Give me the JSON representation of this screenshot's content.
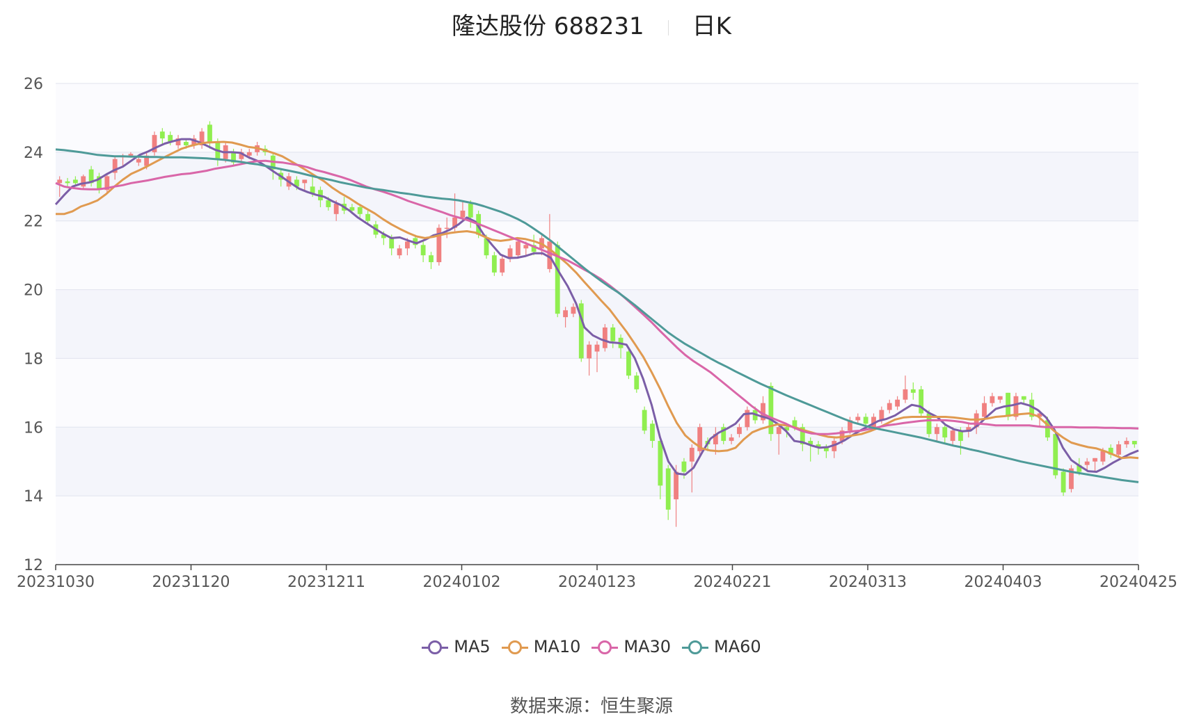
{
  "title": {
    "name": "隆达股份 688231",
    "period": "日K"
  },
  "source": {
    "label": "数据来源：",
    "value": "恒生聚源"
  },
  "colors": {
    "up": "#f08080",
    "down": "#90ee50",
    "ma5": "#7b5ea7",
    "ma10": "#e09a50",
    "ma30": "#d966a8",
    "ma60": "#4e9a98",
    "band": "#f4f5fb",
    "grid": "#e0e3ee"
  },
  "chart_data": {
    "type": "candlestick",
    "title": "隆达股份 688231 日K",
    "ylim": [
      12,
      26
    ],
    "yticks": [
      "26",
      "24",
      "22",
      "20",
      "18",
      "16",
      "14",
      "12"
    ],
    "xticks": [
      "20231030",
      "20231120",
      "20231211",
      "20240102",
      "20240123",
      "20240221",
      "20240313",
      "20240403",
      "20240425"
    ],
    "grid": true,
    "legend_position": "bottom",
    "candles": [
      [
        23.1,
        23.2,
        22.7,
        23.3
      ],
      [
        23.15,
        23.1,
        23.0,
        23.25
      ],
      [
        23.2,
        23.1,
        23.0,
        23.3
      ],
      [
        23.0,
        23.3,
        22.9,
        23.35
      ],
      [
        23.5,
        23.1,
        23.0,
        23.6
      ],
      [
        23.3,
        22.9,
        22.8,
        23.4
      ],
      [
        22.9,
        23.3,
        22.8,
        23.4
      ],
      [
        23.4,
        23.8,
        23.2,
        23.9
      ],
      [
        23.85,
        23.9,
        23.6,
        23.95
      ],
      [
        23.9,
        23.95,
        23.85,
        24.0
      ],
      [
        23.7,
        23.8,
        23.6,
        23.9
      ],
      [
        23.6,
        23.9,
        23.5,
        24.0
      ],
      [
        24.0,
        24.5,
        23.9,
        24.6
      ],
      [
        24.6,
        24.4,
        24.2,
        24.7
      ],
      [
        24.5,
        24.3,
        24.2,
        24.6
      ],
      [
        24.2,
        24.4,
        24.1,
        24.5
      ],
      [
        24.3,
        24.2,
        24.1,
        24.4
      ],
      [
        24.2,
        24.4,
        24.1,
        24.5
      ],
      [
        24.2,
        24.6,
        24.1,
        24.7
      ],
      [
        24.8,
        24.3,
        24.1,
        24.9
      ],
      [
        24.3,
        23.8,
        23.6,
        24.4
      ],
      [
        23.8,
        24.2,
        23.7,
        24.3
      ],
      [
        24.0,
        23.7,
        23.6,
        24.1
      ],
      [
        23.8,
        24.0,
        23.7,
        24.1
      ],
      [
        23.9,
        24.0,
        23.8,
        24.1
      ],
      [
        24.0,
        24.2,
        23.9,
        24.3
      ],
      [
        24.1,
        24.0,
        23.9,
        24.2
      ],
      [
        23.9,
        23.5,
        23.2,
        24.0
      ],
      [
        23.4,
        23.2,
        23.0,
        23.5
      ],
      [
        23.0,
        23.3,
        22.9,
        23.4
      ],
      [
        23.2,
        23.0,
        22.9,
        23.3
      ],
      [
        23.1,
        23.2,
        22.9,
        23.2
      ],
      [
        23.0,
        22.8,
        22.7,
        23.3
      ],
      [
        22.9,
        22.6,
        22.4,
        23.0
      ],
      [
        22.6,
        22.4,
        22.3,
        22.7
      ],
      [
        22.2,
        22.5,
        22.0,
        22.6
      ],
      [
        22.5,
        22.3,
        22.2,
        22.7
      ],
      [
        22.4,
        22.3,
        22.2,
        22.5
      ],
      [
        22.4,
        22.2,
        22.1,
        22.5
      ],
      [
        22.2,
        22.0,
        21.9,
        22.3
      ],
      [
        21.9,
        21.6,
        21.5,
        22.0
      ],
      [
        21.6,
        21.5,
        21.3,
        21.7
      ],
      [
        21.5,
        21.2,
        21.0,
        21.6
      ],
      [
        21.0,
        21.2,
        20.9,
        21.3
      ],
      [
        21.2,
        21.4,
        21.0,
        21.5
      ],
      [
        21.5,
        21.3,
        21.2,
        21.6
      ],
      [
        21.3,
        21.0,
        20.8,
        21.4
      ],
      [
        21.0,
        20.8,
        20.6,
        21.1
      ],
      [
        20.8,
        21.8,
        20.7,
        21.9
      ],
      [
        21.8,
        21.8,
        21.5,
        22.1
      ],
      [
        21.8,
        22.1,
        21.7,
        22.8
      ],
      [
        22.1,
        22.3,
        22.0,
        22.6
      ],
      [
        22.5,
        22.1,
        21.8,
        22.6
      ],
      [
        22.2,
        21.6,
        21.5,
        22.3
      ],
      [
        21.5,
        21.0,
        20.9,
        21.6
      ],
      [
        21.0,
        20.5,
        20.4,
        21.1
      ],
      [
        20.5,
        20.9,
        20.4,
        21.0
      ],
      [
        20.9,
        21.2,
        20.8,
        21.3
      ],
      [
        21.0,
        21.4,
        20.9,
        21.5
      ],
      [
        21.2,
        21.3,
        21.0,
        21.4
      ],
      [
        21.3,
        21.1,
        21.0,
        21.6
      ],
      [
        21.2,
        21.5,
        21.0,
        21.6
      ],
      [
        20.6,
        21.4,
        20.5,
        22.2
      ],
      [
        21.3,
        19.3,
        19.2,
        21.4
      ],
      [
        19.2,
        19.4,
        18.9,
        19.5
      ],
      [
        19.3,
        19.5,
        19.2,
        19.6
      ],
      [
        19.6,
        18.0,
        17.9,
        19.7
      ],
      [
        18.0,
        18.4,
        17.5,
        18.5
      ],
      [
        18.2,
        18.4,
        17.6,
        18.5
      ],
      [
        18.3,
        18.9,
        18.2,
        19.0
      ],
      [
        18.9,
        18.5,
        18.3,
        19.0
      ],
      [
        18.6,
        18.3,
        18.0,
        18.7
      ],
      [
        18.2,
        17.5,
        17.4,
        18.3
      ],
      [
        17.5,
        17.1,
        17.0,
        17.6
      ],
      [
        16.5,
        15.9,
        15.8,
        16.6
      ],
      [
        16.1,
        15.6,
        15.4,
        16.2
      ],
      [
        15.6,
        14.3,
        13.9,
        15.7
      ],
      [
        14.8,
        13.6,
        13.3,
        14.9
      ],
      [
        13.9,
        14.7,
        13.1,
        14.9
      ],
      [
        15.0,
        14.7,
        14.5,
        15.1
      ],
      [
        15.0,
        15.4,
        14.1,
        15.5
      ],
      [
        15.3,
        16.0,
        15.2,
        16.1
      ],
      [
        15.6,
        15.5,
        15.3,
        15.7
      ],
      [
        15.5,
        15.8,
        15.2,
        16.0
      ],
      [
        16.0,
        15.6,
        15.5,
        16.1
      ],
      [
        15.6,
        15.7,
        15.5,
        15.8
      ],
      [
        15.8,
        16.0,
        15.7,
        16.1
      ],
      [
        16.0,
        16.5,
        15.9,
        16.6
      ],
      [
        16.5,
        16.2,
        16.1,
        16.6
      ],
      [
        16.2,
        16.7,
        16.1,
        16.9
      ],
      [
        17.2,
        15.8,
        15.6,
        17.3
      ],
      [
        15.8,
        16.0,
        15.2,
        16.1
      ],
      [
        16.0,
        15.9,
        15.7,
        16.1
      ],
      [
        16.2,
        16.0,
        15.9,
        16.3
      ],
      [
        16.0,
        15.5,
        15.3,
        16.1
      ],
      [
        15.6,
        15.5,
        15.0,
        15.7
      ],
      [
        15.5,
        15.4,
        15.2,
        15.6
      ],
      [
        15.4,
        15.3,
        15.1,
        15.5
      ],
      [
        15.3,
        15.6,
        15.1,
        15.7
      ],
      [
        15.6,
        15.9,
        15.5,
        16.0
      ],
      [
        15.9,
        16.2,
        15.8,
        16.3
      ],
      [
        16.2,
        16.3,
        16.1,
        16.4
      ],
      [
        16.3,
        16.1,
        16.0,
        16.4
      ],
      [
        16.0,
        16.3,
        15.9,
        16.4
      ],
      [
        16.2,
        16.5,
        16.1,
        16.6
      ],
      [
        16.5,
        16.7,
        16.4,
        16.8
      ],
      [
        16.6,
        16.8,
        16.5,
        16.9
      ],
      [
        16.8,
        17.1,
        16.7,
        17.5
      ],
      [
        17.1,
        17.0,
        16.8,
        17.3
      ],
      [
        17.1,
        16.4,
        16.3,
        17.2
      ],
      [
        16.4,
        15.8,
        15.7,
        16.5
      ],
      [
        15.8,
        16.0,
        15.6,
        16.1
      ],
      [
        16.0,
        15.7,
        15.5,
        16.1
      ],
      [
        15.6,
        15.9,
        15.5,
        16.0
      ],
      [
        15.9,
        15.6,
        15.2,
        16.0
      ],
      [
        15.9,
        16.0,
        15.7,
        16.1
      ],
      [
        16.0,
        16.4,
        15.8,
        16.5
      ],
      [
        16.3,
        16.7,
        16.2,
        16.9
      ],
      [
        16.7,
        16.9,
        16.6,
        17.0
      ],
      [
        16.8,
        16.9,
        16.7,
        16.9
      ],
      [
        17.0,
        16.3,
        16.2,
        17.0
      ],
      [
        16.3,
        16.9,
        16.2,
        17.0
      ],
      [
        16.9,
        16.8,
        16.7,
        16.9
      ],
      [
        16.8,
        16.3,
        16.2,
        17.0
      ],
      [
        16.3,
        16.4,
        16.0,
        16.5
      ],
      [
        16.2,
        15.7,
        15.6,
        16.3
      ],
      [
        15.8,
        14.6,
        14.5,
        15.9
      ],
      [
        14.7,
        14.1,
        14.0,
        14.8
      ],
      [
        14.2,
        14.8,
        14.1,
        14.9
      ],
      [
        14.9,
        14.7,
        14.6,
        15.1
      ],
      [
        14.9,
        15.0,
        14.7,
        15.1
      ],
      [
        15.0,
        15.1,
        14.7,
        15.1
      ],
      [
        15.0,
        15.3,
        14.9,
        15.4
      ],
      [
        15.4,
        15.2,
        15.1,
        15.5
      ],
      [
        15.2,
        15.5,
        15.1,
        15.6
      ],
      [
        15.5,
        15.6,
        15.4,
        15.7
      ],
      [
        15.6,
        15.5,
        15.4,
        15.6
      ]
    ],
    "series": [
      {
        "name": "MA5",
        "values": [
          22.48,
          22.75,
          23.0,
          23.08,
          23.12,
          23.2,
          23.35,
          23.48,
          23.58,
          23.75,
          23.92,
          24.02,
          24.14,
          24.25,
          24.32,
          24.38,
          24.38,
          24.3,
          24.19,
          24.07,
          24.0,
          24.0,
          23.98,
          23.85,
          23.75,
          23.6,
          23.43,
          23.27,
          23.1,
          22.94,
          22.84,
          22.76,
          22.7,
          22.57,
          22.46,
          22.3,
          22.1,
          21.94,
          21.78,
          21.63,
          21.5,
          21.52,
          21.43,
          21.35,
          21.45,
          21.58,
          21.64,
          21.75,
          21.9,
          22.1,
          21.98,
          21.6,
          21.3,
          21.02,
          20.92,
          20.93,
          20.98,
          21.06,
          21.06,
          20.92,
          20.5,
          20.1,
          19.6,
          18.9,
          18.67,
          18.55,
          18.47,
          18.45,
          18.4,
          18.0,
          17.4,
          16.65,
          15.7,
          15.0,
          14.65,
          14.62,
          14.82,
          15.26,
          15.66,
          15.84,
          15.96,
          16.1,
          16.38,
          16.4,
          16.32,
          16.25,
          16.1,
          15.89,
          15.6,
          15.56,
          15.47,
          15.4,
          15.42,
          15.5,
          15.62,
          15.78,
          15.92,
          16.05,
          16.18,
          16.24,
          16.34,
          16.5,
          16.65,
          16.6,
          16.42,
          16.3,
          16.07,
          15.94,
          15.88,
          15.9,
          16.08,
          16.32,
          16.53,
          16.6,
          16.64,
          16.7,
          16.63,
          16.5,
          16.28,
          15.92,
          15.4,
          15.04,
          14.87,
          14.72,
          14.7,
          14.82,
          14.97,
          15.1,
          15.22,
          15.32
        ]
      },
      {
        "name": "MA10",
        "values": [
          22.2,
          22.2,
          22.28,
          22.42,
          22.5,
          22.6,
          22.78,
          23.0,
          23.2,
          23.37,
          23.48,
          23.6,
          23.73,
          23.86,
          23.98,
          24.1,
          24.18,
          24.24,
          24.28,
          24.29,
          24.3,
          24.28,
          24.22,
          24.15,
          24.12,
          24.05,
          23.97,
          23.88,
          23.74,
          23.6,
          23.45,
          23.3,
          23.15,
          22.96,
          22.8,
          22.66,
          22.5,
          22.36,
          22.22,
          22.05,
          21.9,
          21.77,
          21.65,
          21.55,
          21.5,
          21.54,
          21.6,
          21.65,
          21.68,
          21.7,
          21.66,
          21.55,
          21.45,
          21.42,
          21.45,
          21.5,
          21.47,
          21.41,
          21.32,
          21.15,
          20.95,
          20.74,
          20.5,
          20.22,
          19.95,
          19.68,
          19.42,
          19.1,
          18.78,
          18.42,
          18.05,
          17.6,
          17.12,
          16.6,
          16.12,
          15.76,
          15.55,
          15.38,
          15.32,
          15.3,
          15.32,
          15.4,
          15.65,
          15.85,
          15.95,
          16.02,
          16.08,
          16.05,
          16.0,
          15.92,
          15.85,
          15.78,
          15.72,
          15.7,
          15.72,
          15.76,
          15.8,
          15.88,
          15.98,
          16.1,
          16.22,
          16.28,
          16.3,
          16.3,
          16.3,
          16.3,
          16.3,
          16.28,
          16.25,
          16.22,
          16.22,
          16.25,
          16.3,
          16.32,
          16.35,
          16.38,
          16.4,
          16.32,
          16.1,
          15.88,
          15.7,
          15.55,
          15.48,
          15.42,
          15.38,
          15.3,
          15.2,
          15.1,
          15.12,
          15.1
        ]
      },
      {
        "name": "MA30",
        "values": [
          23.1,
          23.0,
          22.96,
          22.93,
          22.92,
          22.92,
          22.95,
          23.0,
          23.04,
          23.1,
          23.14,
          23.18,
          23.23,
          23.28,
          23.32,
          23.36,
          23.38,
          23.42,
          23.46,
          23.52,
          23.56,
          23.6,
          23.65,
          23.7,
          23.74,
          23.75,
          23.72,
          23.7,
          23.66,
          23.62,
          23.56,
          23.48,
          23.42,
          23.35,
          23.28,
          23.2,
          23.1,
          23.0,
          22.92,
          22.85,
          22.77,
          22.68,
          22.58,
          22.5,
          22.42,
          22.34,
          22.26,
          22.17,
          22.1,
          22.03,
          21.94,
          21.85,
          21.75,
          21.65,
          21.55,
          21.45,
          21.35,
          21.25,
          21.15,
          21.05,
          20.95,
          20.85,
          20.72,
          20.58,
          20.45,
          20.3,
          20.12,
          19.93,
          19.72,
          19.5,
          19.28,
          19.05,
          18.8,
          18.56,
          18.32,
          18.1,
          17.92,
          17.76,
          17.6,
          17.4,
          17.2,
          17.0,
          16.8,
          16.6,
          16.42,
          16.3,
          16.2,
          16.1,
          15.98,
          15.88,
          15.82,
          15.8,
          15.8,
          15.82,
          15.85,
          15.88,
          15.9,
          15.95,
          16.0,
          16.05,
          16.08,
          16.12,
          16.15,
          16.18,
          16.2,
          16.2,
          16.2,
          16.18,
          16.15,
          16.1,
          16.1,
          16.08,
          16.05,
          16.05,
          16.05,
          16.05,
          16.05,
          16.02,
          16.0,
          16.0,
          16.0,
          16.0,
          15.99,
          15.99,
          15.99,
          15.98,
          15.98,
          15.97,
          15.97,
          15.96
        ]
      },
      {
        "name": "MA60",
        "values": [
          24.08,
          24.06,
          24.03,
          24.0,
          23.96,
          23.92,
          23.9,
          23.88,
          23.88,
          23.87,
          23.87,
          23.86,
          23.86,
          23.85,
          23.85,
          23.85,
          23.84,
          23.83,
          23.82,
          23.8,
          23.78,
          23.75,
          23.72,
          23.68,
          23.65,
          23.6,
          23.55,
          23.5,
          23.45,
          23.4,
          23.34,
          23.28,
          23.23,
          23.18,
          23.12,
          23.07,
          23.02,
          22.97,
          22.93,
          22.9,
          22.86,
          22.82,
          22.79,
          22.75,
          22.71,
          22.68,
          22.65,
          22.63,
          22.6,
          22.55,
          22.5,
          22.43,
          22.35,
          22.27,
          22.17,
          22.06,
          21.93,
          21.77,
          21.6,
          21.42,
          21.22,
          21.02,
          20.82,
          20.62,
          20.43,
          20.25,
          20.08,
          19.92,
          19.74,
          19.55,
          19.35,
          19.15,
          18.95,
          18.75,
          18.58,
          18.42,
          18.28,
          18.14,
          18.0,
          17.87,
          17.75,
          17.62,
          17.5,
          17.38,
          17.26,
          17.15,
          17.04,
          16.93,
          16.83,
          16.73,
          16.63,
          16.53,
          16.43,
          16.33,
          16.23,
          16.14,
          16.07,
          16.0,
          15.95,
          15.9,
          15.85,
          15.8,
          15.75,
          15.7,
          15.64,
          15.58,
          15.52,
          15.46,
          15.41,
          15.35,
          15.3,
          15.24,
          15.18,
          15.12,
          15.06,
          15.0,
          14.95,
          14.9,
          14.85,
          14.8,
          14.75,
          14.7,
          14.66,
          14.62,
          14.58,
          14.54,
          14.5,
          14.46,
          14.43,
          14.4
        ]
      }
    ]
  }
}
